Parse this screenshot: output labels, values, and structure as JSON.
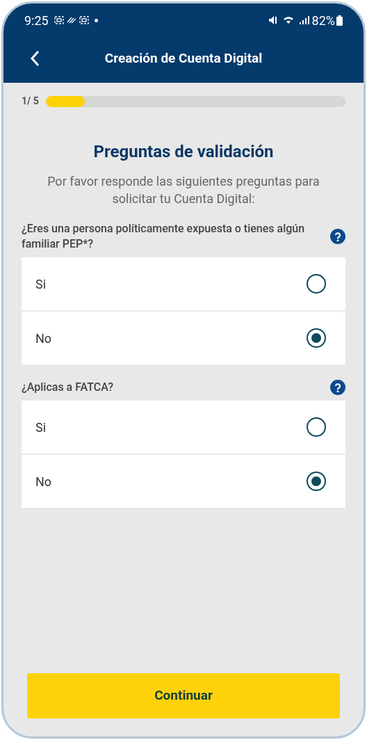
{
  "status_bar": {
    "time": "9:25",
    "battery": "82%"
  },
  "header": {
    "title": "Creación de Cuenta Digital"
  },
  "progress": {
    "step": "1/ 5",
    "level": 0.13
  },
  "title": "Preguntas de validación",
  "subtitle": "Por favor responde las siguientes preguntas para solicitar tu Cuenta Digital:",
  "questions": [
    {
      "text": "¿Eres una persona políticamente expuesta o tienes algún familiar PEP*?",
      "options": [
        {
          "label": "Si",
          "selected": false
        },
        {
          "label": "No",
          "selected": true
        }
      ]
    },
    {
      "text": "¿Aplicas a FATCA?",
      "options": [
        {
          "label": "Si",
          "selected": false
        },
        {
          "label": "No",
          "selected": true
        }
      ]
    }
  ],
  "button": "Continuar"
}
